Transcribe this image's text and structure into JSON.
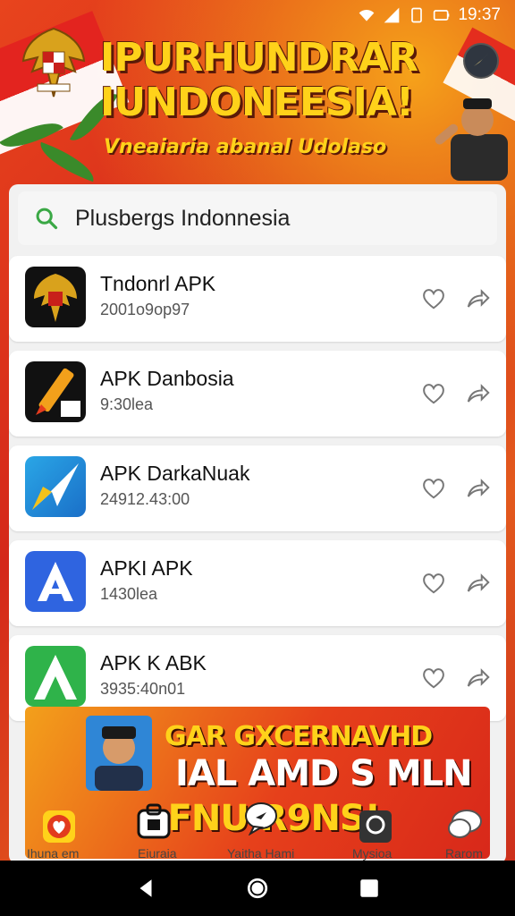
{
  "status_bar": {
    "time": "19:37"
  },
  "banner": {
    "headline_line1": "IPURHUNDRAR",
    "headline_line2": "IUNDONEESIA!",
    "subline": "Vneaiaria abanal Udolaso"
  },
  "search": {
    "query": "Plusbergs Indonnesia",
    "icon": "search-icon"
  },
  "apps": [
    {
      "name": "Tndonrl APK",
      "meta": "2001o9op97",
      "icon": "garuda-emblem-icon",
      "accent": "#111111"
    },
    {
      "name": "APK Danbosia",
      "meta": "9:30lea",
      "icon": "pencil-icon",
      "accent": "#e53b1d"
    },
    {
      "name": "APK DarkaNuak",
      "meta": "24912.43:00",
      "icon": "paper-plane-icon",
      "accent": "#1a8fd8"
    },
    {
      "name": "APKI APK",
      "meta": "1430lea",
      "icon": "letter-a-icon",
      "accent": "#2f64e0"
    },
    {
      "name": "APK K ABK",
      "meta": "3935:40n01",
      "icon": "green-a-icon",
      "accent": "#2fb34a"
    }
  ],
  "ad": {
    "line1": "GAR GXCERNAVHD",
    "line2": "IAL AMD S MLN",
    "line3": "-FNU R9NS!"
  },
  "tabs": [
    {
      "label": "Ihuna em",
      "icon": "heart-badge-icon"
    },
    {
      "label": "Eiuraia",
      "icon": "store-icon"
    },
    {
      "label": "Yaitha Hami",
      "icon": "chat-bubble-icon"
    },
    {
      "label": "Mysioa",
      "icon": "profile-square-icon"
    },
    {
      "label": "Rarom",
      "icon": "speech-icon"
    }
  ],
  "colors": {
    "primary_red": "#d9321f",
    "banner_yellow": "#ffd21a",
    "search_green": "#3aa845"
  }
}
